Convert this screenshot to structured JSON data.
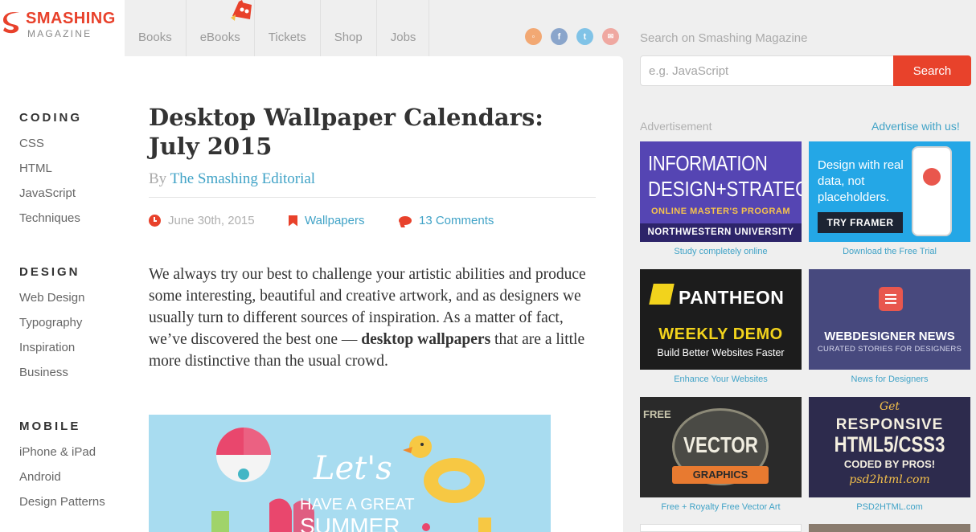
{
  "logo": {
    "line1": "SMASHING",
    "line2": "MAGAZINE"
  },
  "nav": [
    "Books",
    "eBooks",
    "Tickets",
    "Shop",
    "Jobs"
  ],
  "social": [
    {
      "icon": "rss-icon",
      "glyph": "◦"
    },
    {
      "icon": "facebook-icon",
      "glyph": "f"
    },
    {
      "icon": "twitter-icon",
      "glyph": "t"
    },
    {
      "icon": "email-icon",
      "glyph": "✉"
    }
  ],
  "search": {
    "label": "Search on Smashing Magazine",
    "placeholder": "e.g. JavaScript",
    "button": "Search"
  },
  "sidebar": [
    {
      "heading": "CODING",
      "links": [
        "CSS",
        "HTML",
        "JavaScript",
        "Techniques"
      ]
    },
    {
      "heading": "DESIGN",
      "links": [
        "Web Design",
        "Typography",
        "Inspiration",
        "Business"
      ]
    },
    {
      "heading": "MOBILE",
      "links": [
        "iPhone & iPad",
        "Android",
        "Design Patterns"
      ]
    }
  ],
  "article": {
    "title": "Desktop Wallpaper Calendars: July 2015",
    "by": "By",
    "author": "The Smashing Editorial",
    "date": "June 30th, 2015",
    "category": "Wallpapers",
    "comments": "13 Comments",
    "intro_1": "We always try our best to challenge your artistic abilities and produce some interesting, beautiful and creative artwork, and as designers we usually turn to different sources of inspiration. As a matter of fact, we’ve discovered the best one — ",
    "intro_bold": "desktop wallpapers",
    "intro_2": " that are a little more distinctive than the usual crowd.",
    "hero_text": [
      "Let's",
      "HAVE A GREAT",
      "SUMMER"
    ]
  },
  "ads": {
    "label": "Advertisement",
    "advertise_link": "Advertise with us!",
    "items": [
      {
        "lines": [
          "INFORMATION",
          "DESIGN+STRATEGY",
          "ONLINE MASTER'S PROGRAM",
          "NORTHWESTERN UNIVERSITY"
        ],
        "caption": "Study completely online"
      },
      {
        "lines": [
          "Design with real data, not placeholders.",
          "TRY FRAMER"
        ],
        "caption": "Download the Free Trial"
      },
      {
        "lines": [
          "PANTHEON",
          "WEEKLY DEMO",
          "Build Better Websites Faster"
        ],
        "caption": "Enhance Your Websites"
      },
      {
        "lines": [
          "WEBDESIGNER NEWS",
          "CURATED STORIES FOR DESIGNERS"
        ],
        "caption": "News for Designers"
      },
      {
        "lines": [
          "FREE",
          "VECTOR",
          "GRAPHICS"
        ],
        "caption": "Free + Royalty Free Vector Art"
      },
      {
        "lines": [
          "Get",
          "RESPONSIVE",
          "HTML5/CSS3",
          "CODED BY PROS!",
          "psd2html.com"
        ],
        "caption": "PSD2HTML.com"
      }
    ]
  },
  "colors": {
    "accent": "#e8412b",
    "link": "#41a3c7"
  }
}
